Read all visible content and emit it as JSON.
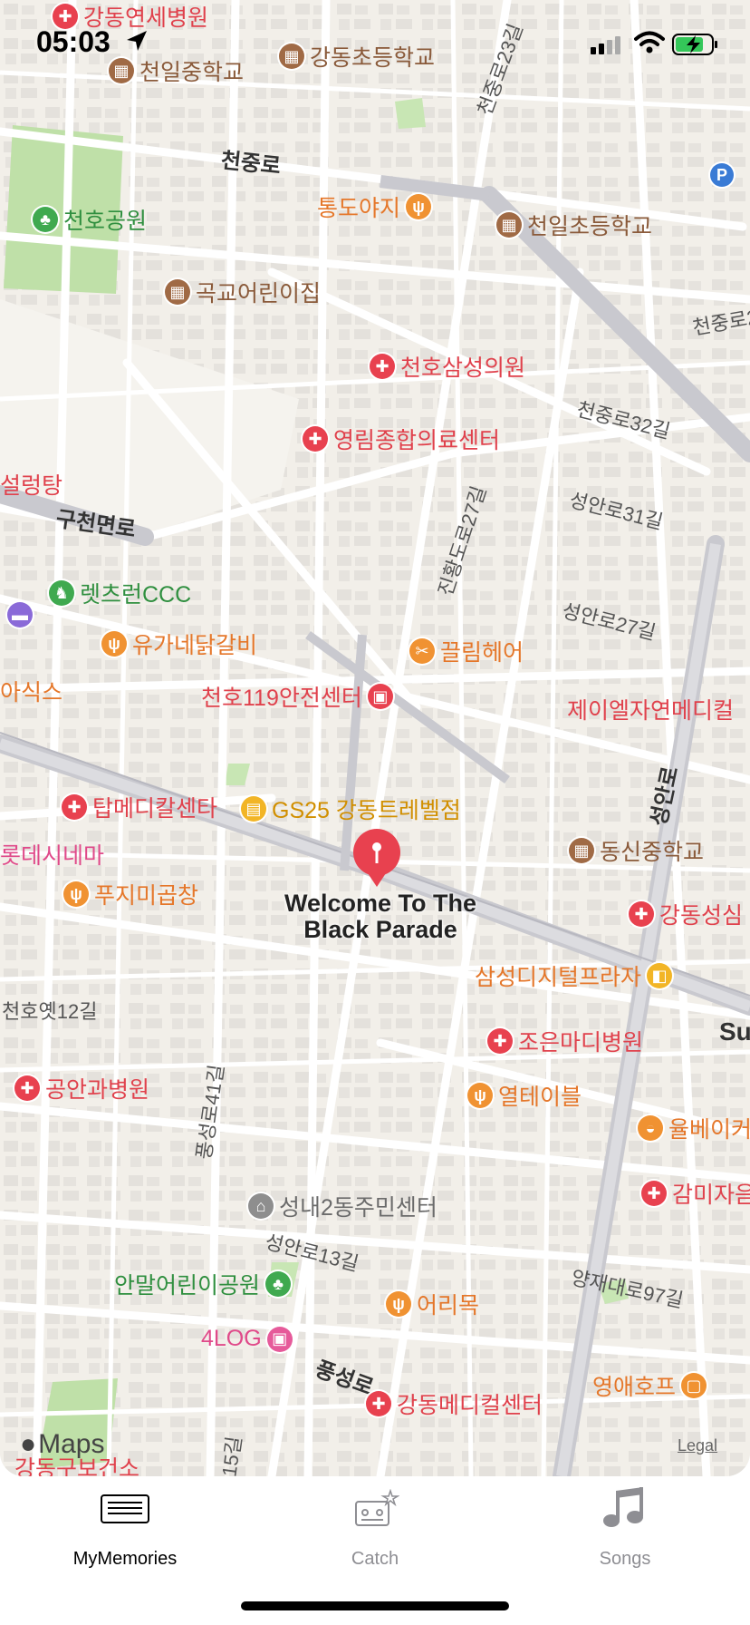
{
  "status_bar": {
    "time": "05:03"
  },
  "map": {
    "pin_title": "Welcome To The Black Parade",
    "pin_title_line1": "Welcome To The",
    "pin_title_line2": "Black Parade",
    "attribution": "Maps",
    "legal": "Legal",
    "pois": {
      "gangdong_severance": "강동연세병원",
      "cheonil_middle": "천일중학교",
      "gangdong_elementary": "강동초등학교",
      "cheonho_park": "천호공원",
      "tongdoyaji": "통도야지",
      "cheonil_elementary": "천일초등학교",
      "gokgyo_kinder": "곡교어린이집",
      "cheonho_samsung": "천호삼성의원",
      "youngrim_medical": "영림종합의료센터",
      "seolleongtang": "설렁탕",
      "lets_run_ccc": "렛츠런CCC",
      "yuga_dakgalbi": "유가네닭갈비",
      "kkeulim_hair": "끌림헤어",
      "asics": "아식스",
      "cheonho_119": "천호119안전센터",
      "jayeon_medical": "제이엘자연메디컬",
      "top_medical": "탑메디칼센타",
      "gs25": "GS25 강동트레벨점",
      "lotte_cinema": "롯데시네마",
      "dongsin_middle": "동신중학교",
      "fuji_gopchang": "푸지미곱창",
      "gangdong_sungsim": "강동성심",
      "samsung_digital": "삼성디지털프라자",
      "joeun_madi": "조은마디병원",
      "gongan_clinic": "공안과병원",
      "yeol_table": "열테이블",
      "yulbeige": "율베이커",
      "seongnae2_center": "성내2동주민센터",
      "gammija": "감미자음",
      "anmal_park": "안말어린이공원",
      "eorimok": "어리목",
      "fourlog": "4LOG",
      "youngae_hof": "영애호프",
      "gangdong_medical": "강동메디컬센터",
      "gangdong_health": "강동구보건소"
    },
    "roads": {
      "cheonjung_ro": "천중로",
      "gucheonmyeon_ro": "구천면로",
      "seongan_ro": "성안로",
      "pungseong_ro": "풍성로",
      "cheonjung_23": "천중로23길",
      "cheonjung_32": "천중로32길",
      "cheonjung_2x": "천중로2",
      "seongan_31": "성안로31길",
      "seongan_27": "성안로27길",
      "seongan_13": "성안로13길",
      "jinhwangdo_27": "진황도로27길",
      "cheonhoyet_12": "천호옛12길",
      "pungseong_41": "풍성로41길",
      "yangjae_97": "양재대로97길",
      "su_partial": "Su",
      "gil_15": "15길"
    }
  },
  "tabs": [
    {
      "label": "MyMemories",
      "icon": "memories-list-icon",
      "selected": true
    },
    {
      "label": "Catch",
      "icon": "cassette-star-icon",
      "selected": false
    },
    {
      "label": "Songs",
      "icon": "music-note-icon",
      "selected": false
    }
  ],
  "colors": {
    "hospital": "#e8414f",
    "school": "#a06a45",
    "food": "#f09232",
    "park": "#3fa94f",
    "tab_selected": "#000000",
    "tab_unselected": "#8e8e93",
    "map_bg": "#f2efe9"
  }
}
